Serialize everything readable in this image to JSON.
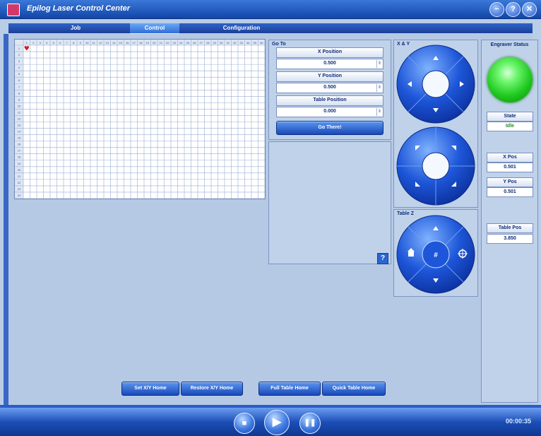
{
  "title": "Epilog Laser Control Center",
  "window_buttons": [
    "−",
    "?",
    "✕"
  ],
  "tabs": [
    "Job",
    "Control",
    "Configuration"
  ],
  "grid": {
    "columns": [
      "1",
      "2",
      "3",
      "4",
      "5",
      "6",
      "7",
      "8",
      "9",
      "10",
      "11",
      "12",
      "13",
      "14",
      "15",
      "16",
      "17",
      "18",
      "19",
      "20",
      "21",
      "22",
      "23",
      "24",
      "25",
      "26",
      "27",
      "28",
      "29",
      "30",
      "31",
      "32",
      "33",
      "34",
      "35",
      "36"
    ],
    "rows": [
      "1",
      "2",
      "3",
      "4",
      "5",
      "6",
      "7",
      "8",
      "9",
      "10",
      "11",
      "12",
      "13",
      "14",
      "15",
      "16",
      "17",
      "18",
      "19",
      "20",
      "21",
      "22",
      "23",
      "24"
    ],
    "marker": "♥"
  },
  "goto": {
    "title": "Go To",
    "x_label": "X Position",
    "x_value": "0.500",
    "y_label": "Y Position",
    "y_value": "0.500",
    "table_label": "Table Position",
    "table_value": "0.000",
    "go_button": "Go There!"
  },
  "xy_panel": {
    "title": "X & Y"
  },
  "tablez_panel": {
    "title": "Table Z"
  },
  "help": "?",
  "status": {
    "title": "Engraver Status",
    "led_color": "#2ad12a",
    "state_label": "State",
    "state_value": "Idle",
    "x_label": "X Pos",
    "x_value": "0.501",
    "y_label": "Y Pos",
    "y_value": "0.501",
    "table_label": "Table Pos",
    "table_value": "3.850"
  },
  "buttons": {
    "set_home": "Set X/Y Home",
    "restore_home": "Restore X/Y Home",
    "full_table_home": "Full Table Home",
    "quick_table_home": "Quick Table Home"
  },
  "player": {
    "stop": "■",
    "play": "▶",
    "pause": "❚❚",
    "time": "00:00:35"
  }
}
